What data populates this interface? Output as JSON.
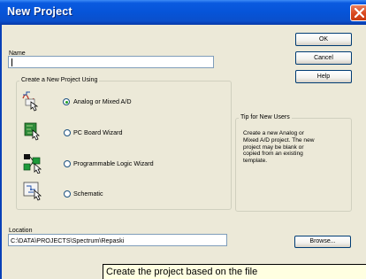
{
  "window": {
    "title": "New Project"
  },
  "name_field": {
    "label": "Name",
    "value": ""
  },
  "buttons": {
    "ok": "OK",
    "cancel": "Cancel",
    "help": "Help",
    "browse": "Browse..."
  },
  "create_group": {
    "legend": "Create a New Project Using",
    "options": [
      {
        "label": "Analog or Mixed A/D",
        "selected": true,
        "icon": "analog-mixed-icon"
      },
      {
        "label": "PC Board Wizard",
        "selected": false,
        "icon": "pc-board-icon"
      },
      {
        "label": "Programmable Logic Wizard",
        "selected": false,
        "icon": "programmable-logic-icon"
      },
      {
        "label": "Schematic",
        "selected": false,
        "icon": "schematic-icon"
      }
    ]
  },
  "tip": {
    "legend": "Tip for New Users",
    "lines": [
      "Create a new Analog or",
      "Mixed A/D project.  The new",
      "project may be blank or",
      "copied from an existing",
      "template."
    ]
  },
  "location": {
    "label": "Location",
    "value": "C:\\DATA\\PROJECTS\\Spectrum\\Repaski"
  },
  "tooltip": {
    "text": "Create the project based on the file"
  },
  "colors": {
    "titlebar": "#0654D8",
    "face": "#ECE9D8",
    "tooltip_bg": "#FFFFE1",
    "close": "#D9481F"
  }
}
